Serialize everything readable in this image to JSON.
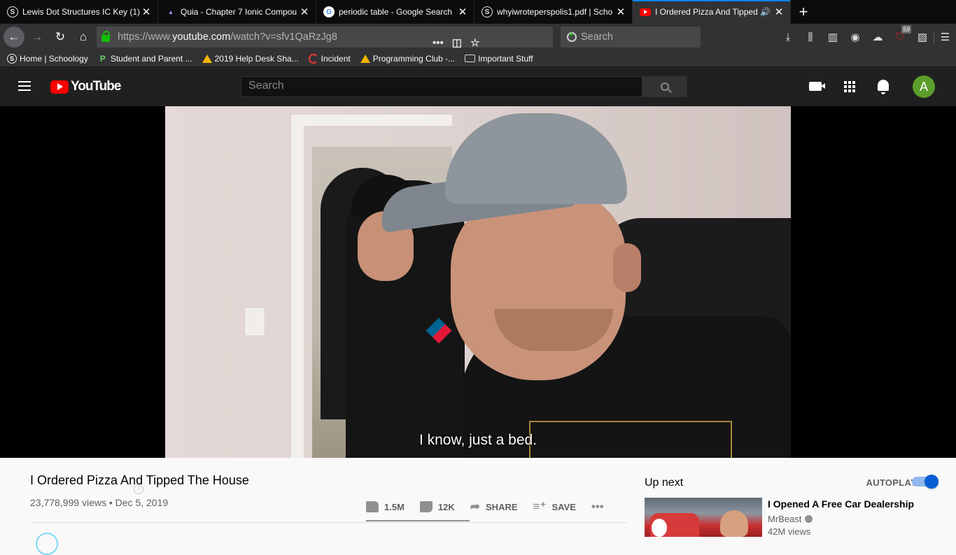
{
  "browser": {
    "tabs": [
      {
        "title": "Lewis Dot Structures IC Key (1)",
        "favicon": "schoology-icon",
        "active": false
      },
      {
        "title": "Quia - Chapter 7 Ionic Compou",
        "favicon": "quia-icon",
        "active": false
      },
      {
        "title": "periodic table - Google Search",
        "favicon": "google-icon",
        "active": false
      },
      {
        "title": "whyiwroteperspolis1.pdf | Scho",
        "favicon": "schoology-icon",
        "active": false
      },
      {
        "title": "I Ordered Pizza And Tipped",
        "favicon": "youtube-icon",
        "active": true,
        "audio": true
      }
    ],
    "close_glyph": "✕",
    "newtab_glyph": "+",
    "url_prefix": "https://www.",
    "url_domain": "youtube.com",
    "url_path": "/watch?v=sfv1QaRzJg8",
    "search_placeholder": "Search",
    "addon_badge": "59",
    "bookmarks": [
      {
        "label": "Home | Schoology",
        "icon": "schoology-icon"
      },
      {
        "label": "Student and Parent ...",
        "icon": "powerschool-icon"
      },
      {
        "label": "2019 Help Desk Sha...",
        "icon": "drive-icon"
      },
      {
        "label": "Incident",
        "icon": "incident-icon"
      },
      {
        "label": "Programming Club -...",
        "icon": "drive-icon"
      },
      {
        "label": "Important Stuff",
        "icon": "folder-icon"
      }
    ]
  },
  "youtube": {
    "logo_text": "YouTube",
    "search_placeholder": "Search",
    "avatar_letter": "A",
    "caption": "I know, just a bed.",
    "video": {
      "title": "I Ordered Pizza And Tipped The House",
      "views": "23,778,999 views",
      "date": "Dec 5, 2019",
      "likes": "1.5M",
      "dislikes": "12K",
      "share_label": "SHARE",
      "save_label": "SAVE",
      "like_ratio": 0.992
    },
    "up_next": {
      "heading": "Up next",
      "autoplay_label": "AUTOPLAY",
      "autoplay_on": true,
      "title": "I Opened A Free Car Dealership",
      "channel": "MrBeast",
      "views": "42M views"
    }
  },
  "colors": {
    "accent": "#0a84ff",
    "yt_red": "#ff0000",
    "autoplay_blue": "#065fd4",
    "avatar_green": "#5c9e2b"
  }
}
